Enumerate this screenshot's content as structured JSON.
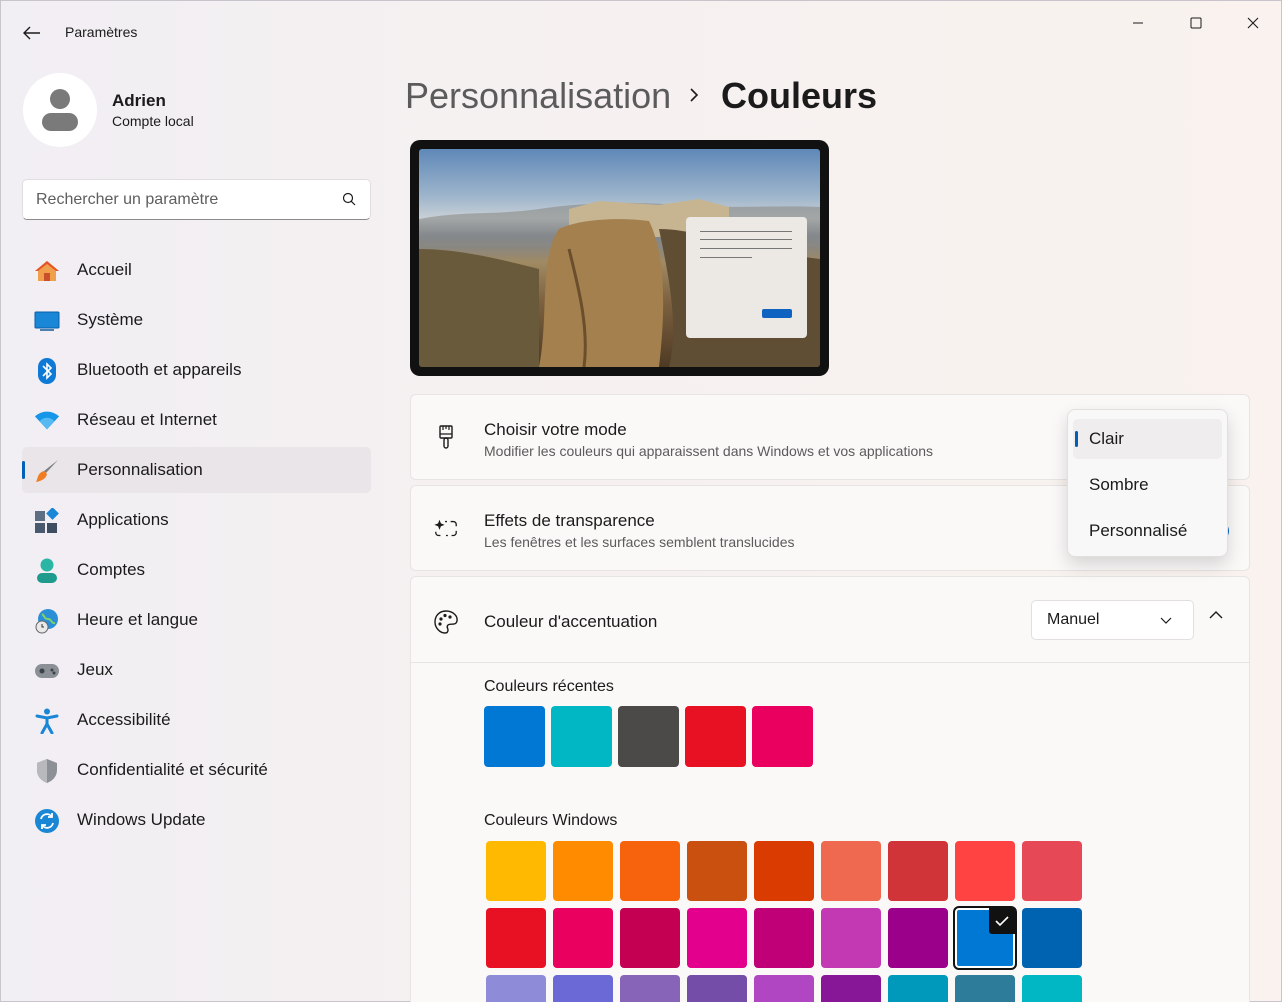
{
  "titlebar": {
    "app_title": "Paramètres",
    "back_icon": "arrow-left-icon",
    "minimize_icon": "minimize-icon",
    "maximize_icon": "maximize-icon",
    "close_icon": "close-icon"
  },
  "profile": {
    "name": "Adrien",
    "account_type": "Compte local"
  },
  "search": {
    "placeholder": "Rechercher un paramètre"
  },
  "sidebar": {
    "items": [
      {
        "label": "Accueil",
        "icon": "home-icon"
      },
      {
        "label": "Système",
        "icon": "monitor-icon"
      },
      {
        "label": "Bluetooth et appareils",
        "icon": "bluetooth-icon"
      },
      {
        "label": "Réseau et Internet",
        "icon": "wifi-icon"
      },
      {
        "label": "Personnalisation",
        "icon": "paintbrush-icon",
        "active": true
      },
      {
        "label": "Applications",
        "icon": "apps-icon"
      },
      {
        "label": "Comptes",
        "icon": "account-icon"
      },
      {
        "label": "Heure et langue",
        "icon": "globe-clock-icon"
      },
      {
        "label": "Jeux",
        "icon": "gamepad-icon"
      },
      {
        "label": "Accessibilité",
        "icon": "accessibility-icon"
      },
      {
        "label": "Confidentialité et sécurité",
        "icon": "shield-icon"
      },
      {
        "label": "Windows Update",
        "icon": "update-icon"
      }
    ]
  },
  "breadcrumb": {
    "parent": "Personnalisation",
    "current": "Couleurs"
  },
  "mode_card": {
    "title": "Choisir votre mode",
    "subtitle": "Modifier les couleurs qui apparaissent dans Windows et vos applications",
    "icon": "brush-icon"
  },
  "transparency_card": {
    "title": "Effets de transparence",
    "subtitle": "Les fenêtres et les surfaces semblent translucides",
    "icon": "sparkle-selection-icon"
  },
  "accent_card": {
    "title": "Couleur d'accentuation",
    "icon": "palette-icon",
    "dropdown_value": "Manuel",
    "recent_label": "Couleurs récentes",
    "windows_label": "Couleurs Windows",
    "recent_colors": [
      "#0078d4",
      "#00b7c3",
      "#4c4a48",
      "#e81123",
      "#ea005e"
    ],
    "windows_colors": [
      [
        "#ffb900",
        "#ff8c00",
        "#f7630c",
        "#ca5010",
        "#da3b01",
        "#ef6950",
        "#d13438",
        "#ff4343",
        "#e74856"
      ],
      [
        "#e81123",
        "#ea005e",
        "#c30052",
        "#e3008c",
        "#bf0077",
        "#c239b3",
        "#9a0089",
        "#0078d4",
        "#0063b1"
      ],
      [
        "#8e8cd8",
        "#6b69d6",
        "#8764b8",
        "#744da9",
        "#b146c2",
        "#881798",
        "#0099bc",
        "#2d7d9a",
        "#00b7c3"
      ]
    ],
    "selected_color": "#0078d4"
  },
  "mode_flyout": {
    "options": [
      "Clair",
      "Sombre",
      "Personnalisé"
    ],
    "selected": "Clair"
  },
  "colors": {
    "accent": "#005fb8"
  }
}
